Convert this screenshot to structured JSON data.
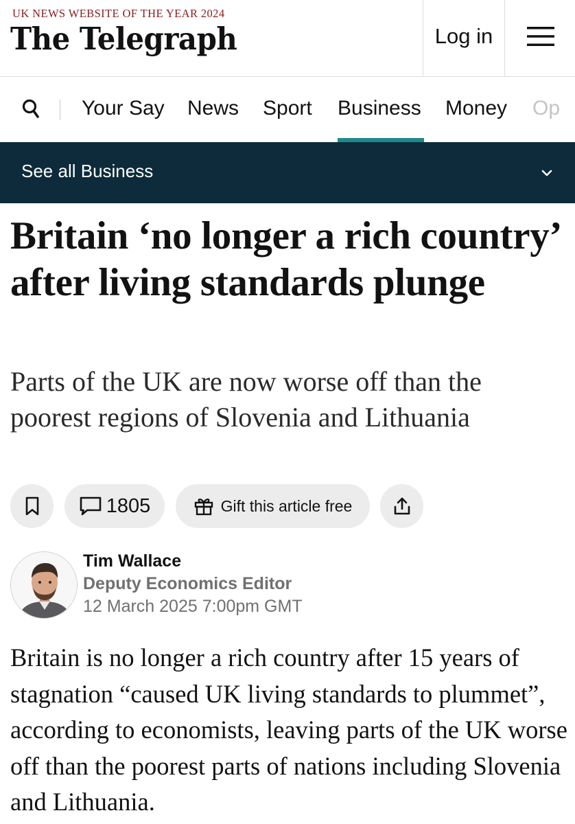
{
  "masthead": {
    "award_text": "UK NEWS WEBSITE OF THE YEAR 2024",
    "logo_text": "The Telegraph",
    "login_label": "Log in",
    "menu_icon": "hamburger-icon"
  },
  "nav": {
    "search_icon": "search-icon",
    "items": [
      {
        "label": "Your Say",
        "active": false
      },
      {
        "label": "News",
        "active": false
      },
      {
        "label": "Sport",
        "active": false
      },
      {
        "label": "Business",
        "active": true
      },
      {
        "label": "Money",
        "active": false
      },
      {
        "label": "Op",
        "active": false
      }
    ],
    "active_color": "#1f8a8a"
  },
  "section_bar": {
    "label": "See all Business",
    "chevron_icon": "chevron-down-icon",
    "background": "#0d2b3a"
  },
  "article": {
    "headline": "Britain ‘no longer a rich country’ after living standards plunge",
    "standfirst": "Parts of the UK are now worse off than the poorest regions of Slovenia and Lithuania",
    "actions": {
      "bookmark_icon": "bookmark-icon",
      "comment_icon": "comment-icon",
      "comment_count": "1805",
      "gift_icon": "gift-icon",
      "gift_label": "Gift this article free",
      "share_icon": "share-icon"
    },
    "author": {
      "name": "Tim Wallace",
      "role": "Deputy Economics Editor",
      "date": "12 March 2025 7:00pm GMT"
    },
    "body": "Britain is no longer a rich country after 15 years of stagnation “caused UK living standards to plummet”, according to economists, leaving parts of the UK worse off than the poorest parts of nations including Slovenia and Lithuania."
  }
}
